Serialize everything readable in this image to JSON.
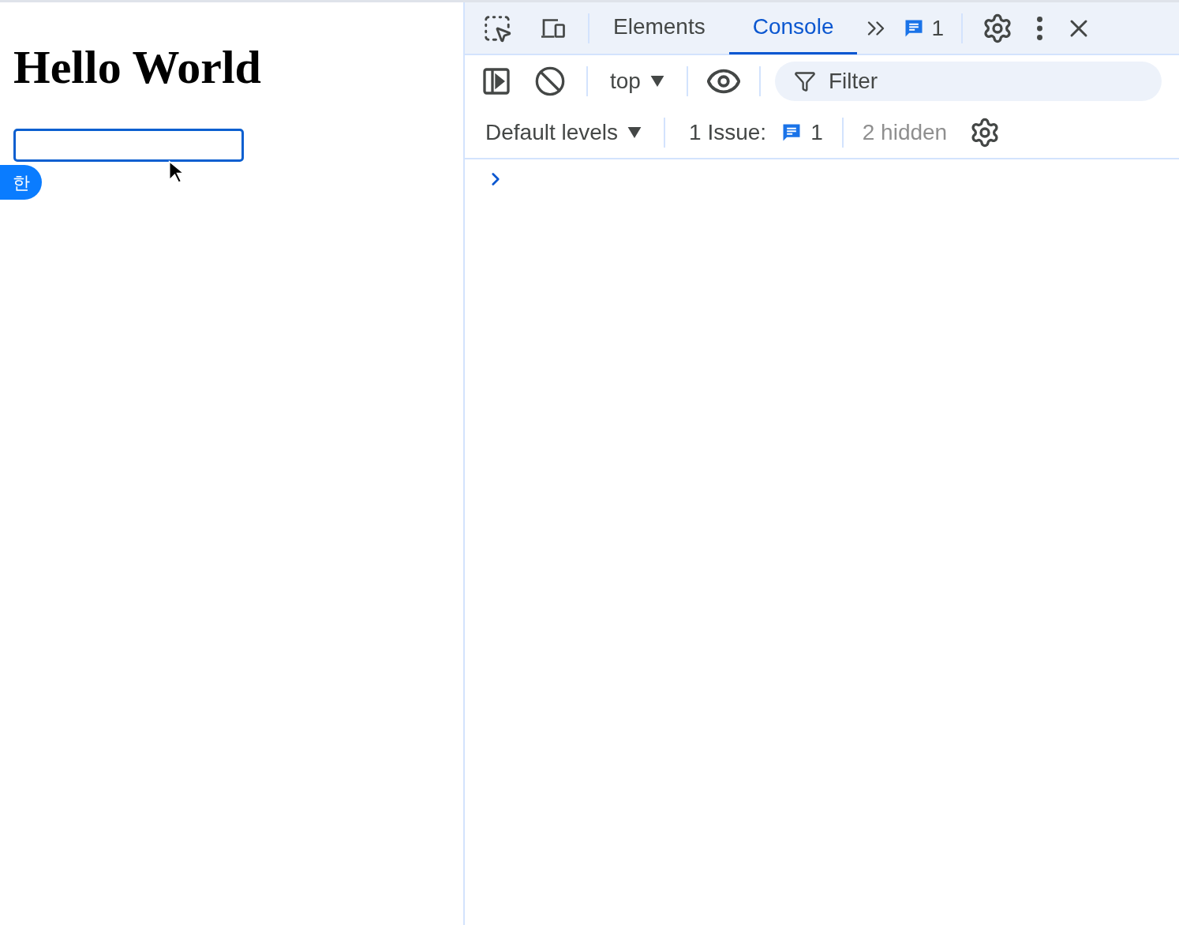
{
  "page": {
    "heading": "Hello World",
    "input": {
      "focused": true
    },
    "ime_badge": "한"
  },
  "devtools": {
    "tabs": [
      {
        "label": "Elements",
        "selected": false
      },
      {
        "label": "Console",
        "selected": true
      }
    ],
    "issues_badge": "1",
    "context": "top",
    "filter": {
      "placeholder": "Filter"
    },
    "levels": "Default levels",
    "issues_label": "1 Issue:",
    "issues_count": "1",
    "hidden": "2 hidden"
  }
}
